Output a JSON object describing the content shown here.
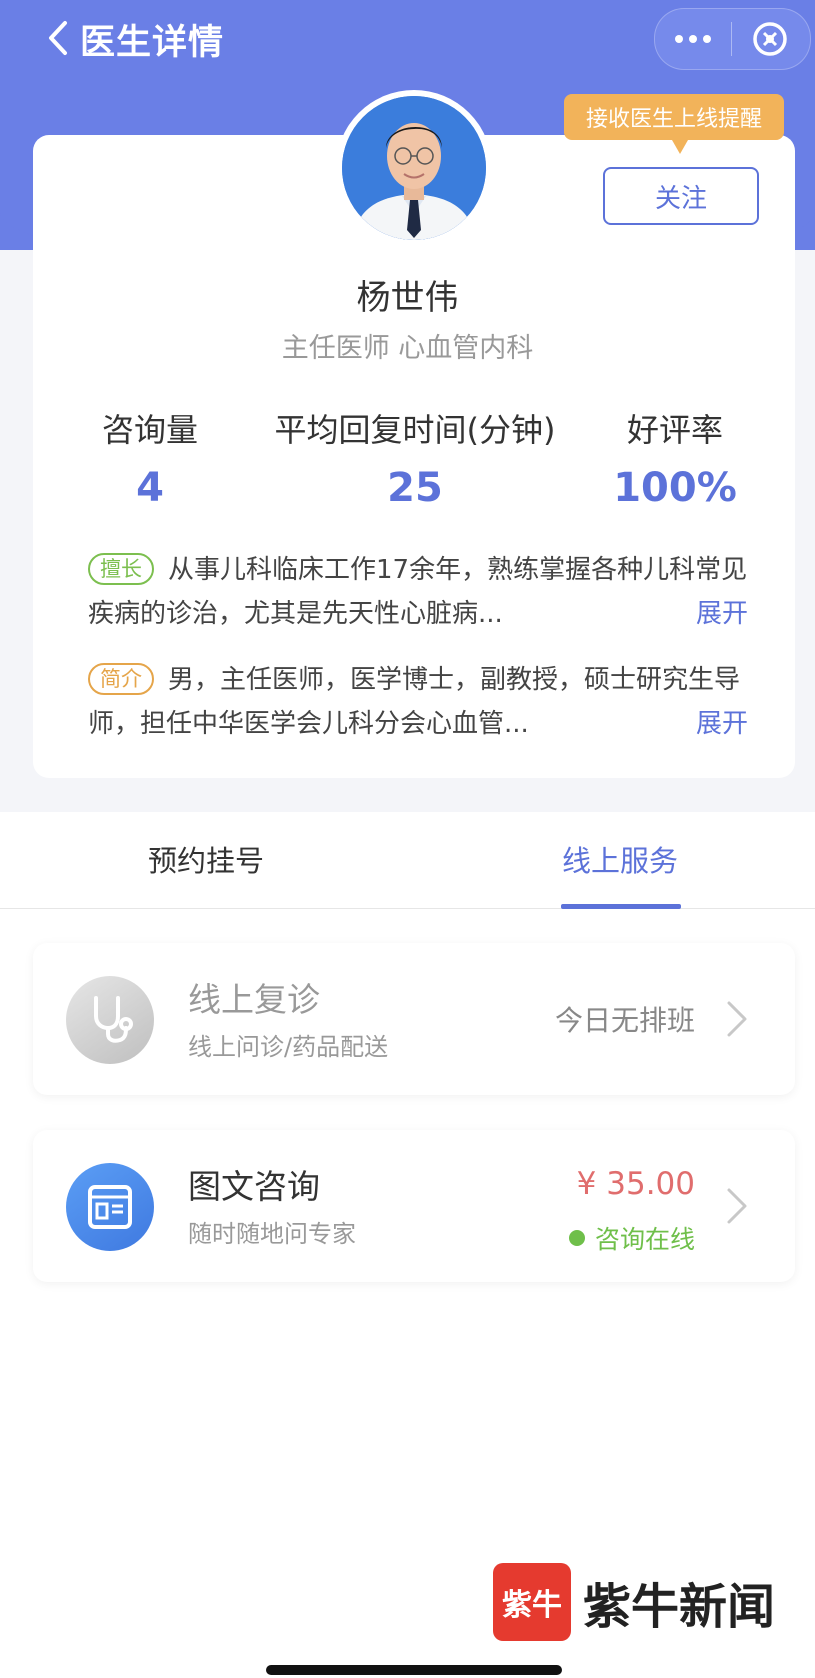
{
  "nav": {
    "title": "医生详情"
  },
  "doctor": {
    "name": "杨世伟",
    "title": "主任医师 心血管内科",
    "follow_label": "关注",
    "reminder_tip": "接收医生上线提醒"
  },
  "stats": [
    {
      "label": "咨询量",
      "value": "4"
    },
    {
      "label": "平均回复时间(分钟)",
      "value": "25"
    },
    {
      "label": "好评率",
      "value": "100%"
    }
  ],
  "intro": {
    "specialty": {
      "tag": "擅长",
      "text": "从事儿科临床工作17余年，熟练掌握各种儿科常见疾病的诊治，尤其是先天性心脏病...",
      "expand": "展开"
    },
    "bio": {
      "tag": "简介",
      "text": "男，主任医师，医学博士，副教授，硕士研究生导师，担任中华医学会儿科分会心血管...",
      "expand": "展开"
    }
  },
  "tabs": [
    {
      "label": "预约挂号",
      "active": false
    },
    {
      "label": "线上服务",
      "active": true
    }
  ],
  "services": [
    {
      "title": "线上复诊",
      "subtitle": "线上问诊/药品配送",
      "status": "今日无排班",
      "icon": "stethoscope-icon"
    },
    {
      "title": "图文咨询",
      "subtitle": "随时随地问专家",
      "price": "¥ 35.00",
      "status": "咨询在线",
      "icon": "document-icon"
    }
  ],
  "watermark": {
    "logo_text": "紫牛",
    "text": "紫牛新闻"
  },
  "colors": {
    "primary": "#5c72d9",
    "header": "#6a7fe6",
    "price": "#e06d6d",
    "online": "#6fbf4a",
    "tip": "#f2b35a"
  }
}
